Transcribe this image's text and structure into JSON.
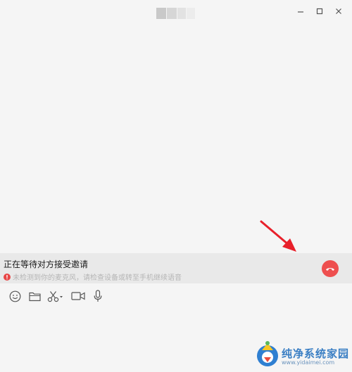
{
  "window": {
    "title_blur_colors": [
      "#c9c9c9",
      "#d6d6d6",
      "#e2e2e2",
      "#ececec"
    ],
    "controls": [
      "minimize-icon",
      "maximize-icon",
      "close-icon"
    ]
  },
  "call": {
    "status_text": "正在等待对方接受邀请",
    "warning_text": "未检测到你的麦克风，请检查设备或转至手机继续语音",
    "hangup_icon": "phone-hangup-icon"
  },
  "toolbar": {
    "items": [
      "emoji-icon",
      "folder-icon",
      "scissors-icon",
      "video-camera-icon",
      "microphone-icon"
    ]
  },
  "colors": {
    "hangup": "#ee4f4f",
    "warning": "#e84545",
    "arrow": "#e8202a",
    "status_bar": "#e9e9e9",
    "background": "#f5f5f5"
  },
  "watermark": {
    "title": "纯净系统家园",
    "url": "www.yidaimei.com"
  }
}
